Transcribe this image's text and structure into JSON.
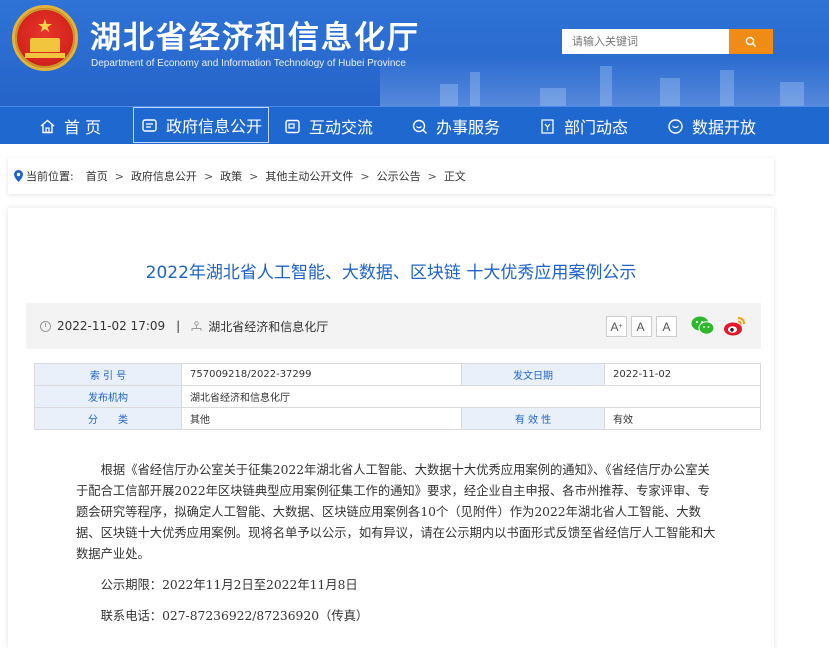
{
  "header": {
    "title": "湖北省经济和信息化厅",
    "subtitle": "Department of Economy and Information Technology of Hubei Province",
    "search_placeholder": "请输入关键词"
  },
  "nav": {
    "items": [
      {
        "label": "首 页",
        "icon": "home-icon"
      },
      {
        "label": "政府信息公开",
        "icon": "info-icon",
        "active": true
      },
      {
        "label": "互动交流",
        "icon": "interaction-icon"
      },
      {
        "label": "办事服务",
        "icon": "service-icon"
      },
      {
        "label": "部门动态",
        "icon": "news-icon"
      },
      {
        "label": "数据开放",
        "icon": "data-icon"
      }
    ]
  },
  "breadcrumb": {
    "prefix": "当前位置:",
    "items": [
      "首页",
      "政府信息公开",
      "政策",
      "其他主动公开文件",
      "公示公告",
      "正文"
    ]
  },
  "article": {
    "title": "2022年湖北省人工智能、大数据、区块链 十大优秀应用案例公示",
    "date": "2022-11-02 17:09",
    "org": "湖北省经济和信息化厅",
    "font_buttons": [
      "A+",
      "A",
      "A"
    ],
    "share": [
      "wechat-icon",
      "weibo-icon"
    ]
  },
  "info_table": {
    "index_label": "索 引 号",
    "index_value": "757009218/2022-37299",
    "date_label": "发文日期",
    "date_value": "2022-11-02",
    "issuer_label": "发布机构",
    "issuer_value": "湖北省经济和信息化厅",
    "category_label": "分　　类",
    "category_value": "其他",
    "validity_label": "有 效 性",
    "validity_value": "有效"
  },
  "body": {
    "paragraph1": "根据《省经信厅办公室关于征集2022年湖北省人工智能、大数据十大优秀应用案例的通知》、《省经信厅办公室关于配合工信部开展2022年区块链典型应用案例征集工作的通知》要求，经企业自主申报、各市州推荐、专家评审、专题会研究等程序，拟确定人工智能、大数据、区块链应用案例各10个（见附件）作为2022年湖北省人工智能、大数据、区块链十大优秀应用案例。现将名单予以公示，如有异议，请在公示期内以书面形式反馈至省经信厅人工智能和大数据产业处。",
    "period": "公示期限：2022年11月2日至2022年11月8日",
    "phone": "联系电话：027-87236922/87236920（传真）"
  },
  "colors": {
    "header_blue": "#2f73d6",
    "nav_blue": "#1f68d0",
    "title_blue": "#1e63c8",
    "search_orange": "#f08c15"
  }
}
